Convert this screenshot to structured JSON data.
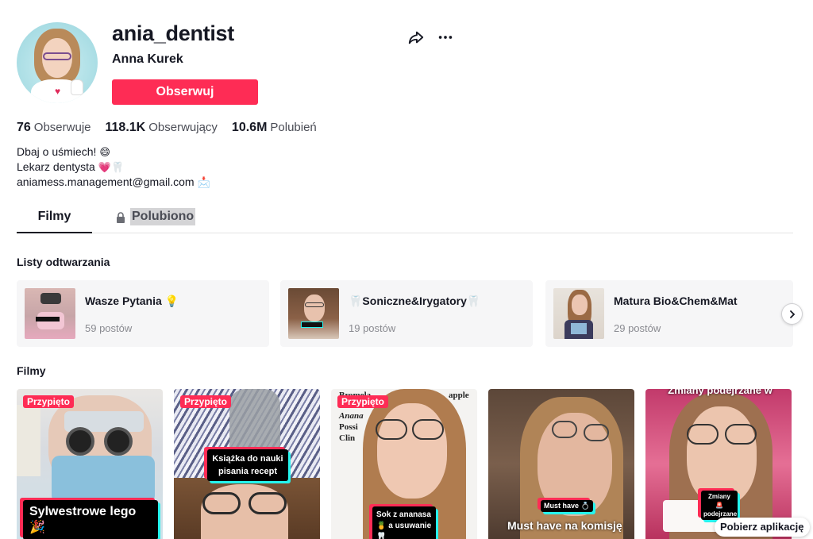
{
  "profile": {
    "username": "ania_dentist",
    "real_name": "Anna Kurek",
    "follow_label": "Obserwuj",
    "avatar_icon": "avatar-woman-glasses",
    "share_icon": "share-arrow-icon",
    "more_icon": "more-dots-icon"
  },
  "stats": {
    "following_count": "76",
    "following_label": "Obserwuje",
    "followers_count": "118.1K",
    "followers_label": "Obserwujący",
    "likes_count": "10.6M",
    "likes_label": "Polubień"
  },
  "bio": {
    "line1": "Dbaj o uśmiech!",
    "line1_emoji": "😄",
    "line2": "Lekarz dentysta",
    "line2_emoji": "💗🦷",
    "line3": "aniamess.management@gmail.com",
    "line3_emoji": "📩"
  },
  "tabs": {
    "films": "Filmy",
    "liked": "Polubiono"
  },
  "playlists": {
    "title": "Listy odtwarzania",
    "items": [
      {
        "title": "Wasze Pytania 💡",
        "count": "59 postów"
      },
      {
        "title": "🦷Soniczne&Irygatory🦷",
        "count": "19 postów"
      },
      {
        "title": "Matura Bio&Chem&Mat",
        "count": "29 postów"
      }
    ]
  },
  "videos": {
    "title": "Filmy",
    "pinned_label": "Przypięto",
    "items": [
      {
        "caption": "Sylwestrowe lego 🎉",
        "pinned": true
      },
      {
        "caption": "Książka do nauki pisania recept",
        "pinned": true
      },
      {
        "caption": "Sok z ananasa🍍 a usuwanie 🦷",
        "pinned": true,
        "bg_text_1": "Bromela",
        "bg_text_2": "apple",
        "bg_text_3": "Anana",
        "bg_text_4": "Possi",
        "bg_text_5": "Clin"
      },
      {
        "caption": "Must have 💍",
        "bottom_text": "Must have na komisję",
        "pinned": false
      },
      {
        "caption": "Zmiany 🚨 podejrzane",
        "top_text": "Zmiany podejrzane w",
        "pinned": false
      }
    ]
  },
  "get_app_label": "Pobierz aplikację",
  "colors": {
    "accent": "#fe2c55",
    "text": "#161823",
    "secondary": "#4a4c55"
  }
}
